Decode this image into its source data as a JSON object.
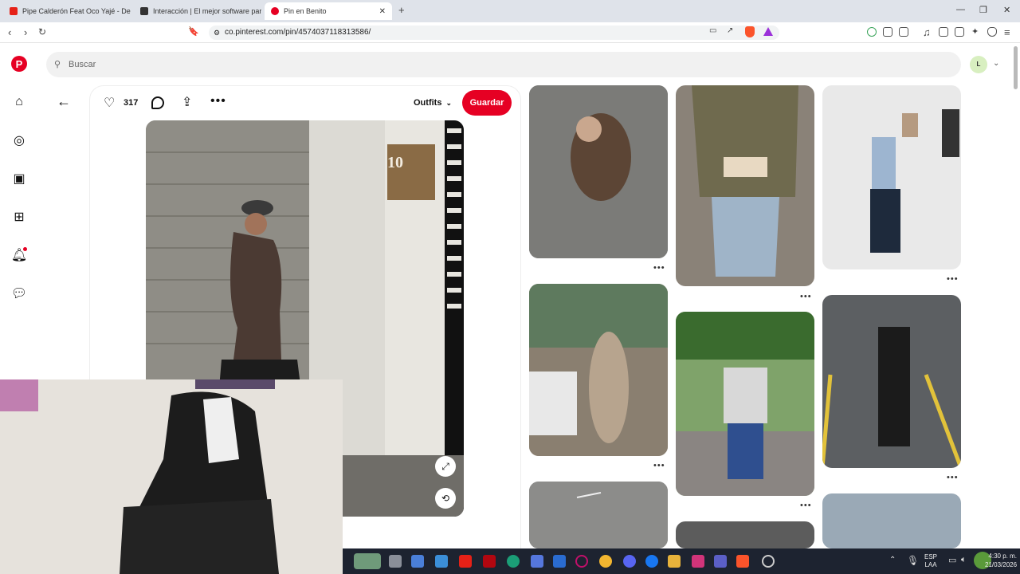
{
  "browser": {
    "tabs": [
      {
        "label": "Pipe Calderón Feat Oco Yajé - De Re",
        "favicon_color": "#e62117"
      },
      {
        "label": "Interacción | El mejor software para p",
        "favicon_color": "#333333"
      },
      {
        "label": "Pin en Benito",
        "favicon_color": "#e60023"
      }
    ],
    "new_tab": "+",
    "url": "co.pinterest.com/pin/4574037118313586/"
  },
  "pinterest": {
    "brand_color": "#e60023",
    "search_placeholder": "Buscar",
    "avatar_initial": "L",
    "pin": {
      "likes": "317",
      "board": "Outfits",
      "save_label": "Guardar",
      "sign_number": "10"
    },
    "sidebar_icons": [
      "home-icon",
      "explore-icon",
      "boards-icon",
      "create-icon",
      "notifications-icon",
      "messages-icon"
    ]
  },
  "taskbar": {
    "lang": "ESP",
    "lang2": "LAA",
    "time": "4:30 p. m.",
    "date": "21/03/2026"
  }
}
